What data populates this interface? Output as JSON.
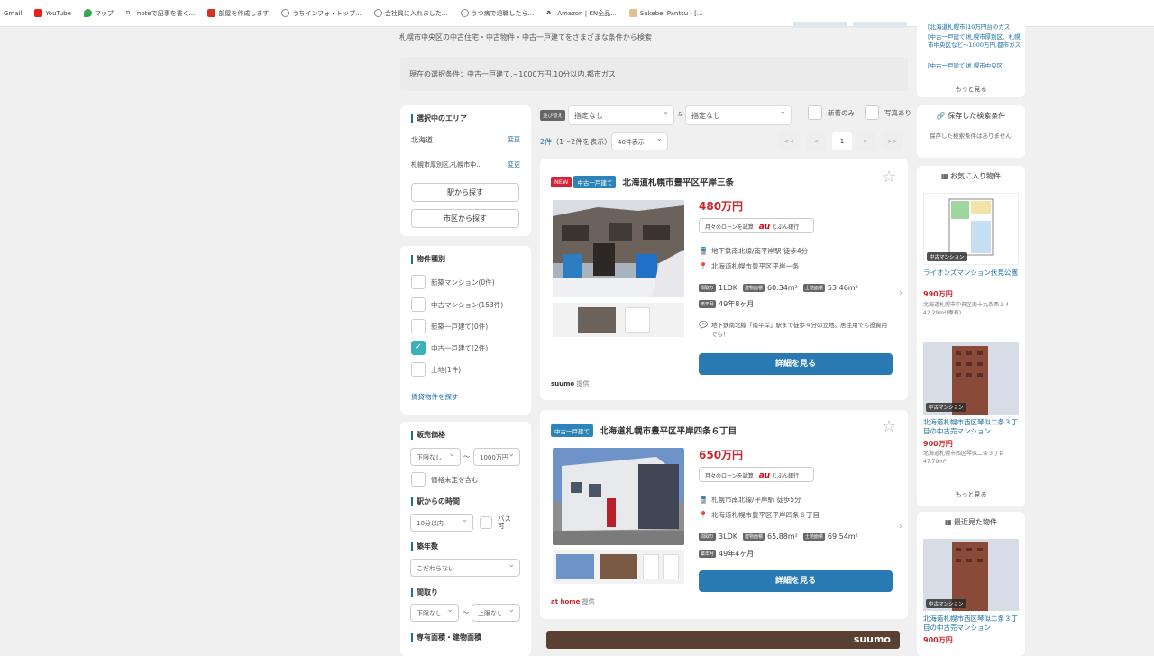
{
  "bookmarks": [
    {
      "label": "Gmail",
      "color": "#ffffff"
    },
    {
      "label": "YouTube",
      "color": "#e62117"
    },
    {
      "label": "マップ",
      "color": "#34a853"
    },
    {
      "label": "noteで記事を書く...",
      "color": "#222222"
    },
    {
      "label": "部屋を作成します",
      "color": "#d93025"
    },
    {
      "label": "うちインフォ・トップ...",
      "color": "#999999"
    },
    {
      "label": "会社員に入れました...",
      "color": "#999999"
    },
    {
      "label": "うつ病で退職したら...",
      "color": "#999999"
    },
    {
      "label": "Amazon | KN全品...",
      "color": "#222222"
    },
    {
      "label": "Sukebei Pantsu - [...",
      "color": "#e0c090"
    }
  ],
  "page": {
    "subtitle": "札幌市中央区の中古住宅・中古物件・中古一戸建てをさまざまな条件から検索",
    "current_conditions": "現在の選択条件：中古一戸建て,~1000万円,10分以内,都市ガス"
  },
  "sidebar": {
    "area_title": "選択中のエリア",
    "area1": "北海道",
    "area2": "札幌市厚別区,札幌市中...",
    "change": "変更",
    "station_btn": "駅から探す",
    "city_btn": "市区から探す",
    "type_title": "物件種別",
    "types": [
      {
        "label": "新築マンション(0件)",
        "checked": false
      },
      {
        "label": "中古マンション(153件)",
        "checked": false
      },
      {
        "label": "新築一戸建て(0件)",
        "checked": false
      },
      {
        "label": "中古一戸建て(2件)",
        "checked": true
      },
      {
        "label": "土地(1件)",
        "checked": false
      }
    ],
    "rent_link": "賃貸物件を探す",
    "price_title": "販売価格",
    "price_min": "下限なし",
    "price_sep": "〜",
    "price_max": "1000万円",
    "price_undecided": "価格未定を含む",
    "walk_title": "駅からの時間",
    "walk_val": "10分以内",
    "bus": "バス可",
    "age_title": "築年数",
    "age_val": "こだわらない",
    "layout_title": "間取り",
    "layout_min": "下限なし",
    "layout_max": "上限なし",
    "area_size_title": "専有面積・建物面積"
  },
  "toolbar": {
    "sort_badge": "並び替え",
    "sort1": "指定なし",
    "amp": "&",
    "sort2": "指定なし",
    "newonly": "新着のみ",
    "photo": "写真あり",
    "count_num": "2件",
    "count_text": "（1〜2件を表示）",
    "perpage": "40件表示",
    "pager": [
      "<<",
      "<",
      "1",
      ">",
      ">>"
    ]
  },
  "listings": [
    {
      "new": "NEW",
      "type": "中古一戸建て",
      "title": "北海道札幌市豊平区平岸三条",
      "price": "480万円",
      "loan": "月々のローンを試算",
      "bank": "au",
      "bank_label": "じぶん銀行",
      "station": "地下鉄南北線/南平岸駅 徒歩4分",
      "address": "北海道札幌市豊平区平岸一条",
      "layout_tag": "間取り",
      "layout": "1LDK",
      "bld_tag": "建物面積",
      "bld": "60.34m²",
      "land_tag": "土地面積",
      "land": "53.46m²",
      "age_tag": "築年月",
      "age": "49年8ヶ月",
      "comment": "地下鉄南北線「南平岸」駅まで徒歩４分の立地。居住用でも投資用でも！",
      "detail": "詳細を見る",
      "source": "suumo",
      "source_tail": "提供"
    },
    {
      "type": "中古一戸建て",
      "title": "北海道札幌市豊平区平岸四条６丁目",
      "price": "650万円",
      "loan": "月々のローンを試算",
      "bank": "au",
      "bank_label": "じぶん銀行",
      "station": "札幌市南北線/平岸駅 徒歩5分",
      "address": "北海道札幌市豊平区平岸四条６丁目",
      "layout_tag": "間取り",
      "layout": "3LDK",
      "bld_tag": "建物面積",
      "bld": "65.88m²",
      "land_tag": "土地面積",
      "land": "69.54m²",
      "age_tag": "築年月",
      "age": "49年4ヶ月",
      "detail": "詳細を見る",
      "source": "at home",
      "source_tail": "提供"
    }
  ],
  "right": {
    "top_links": [
      "[北海道札幌市]10万円台のガス",
      "[中古一戸建て]札幌市厚別区、札幌市中央区など〜1000万円,都市ガス",
      "[中古一戸建て]札幌市中央区"
    ],
    "more": "もっと見る",
    "saved_title": "保存した検索条件",
    "saved_empty": "保存した検索条件はありません",
    "fav_title": "お気に入り物件",
    "fav": [
      {
        "tag": "中古マンション",
        "name": "ライオンズマンション伏見公園",
        "price": "990万円",
        "addr": "北海道札幌市中央区南十九条西１４ 42.29m²(専有)"
      },
      {
        "tag": "中古マンション",
        "name": "北海道札幌市西区琴似二条３丁目の中古売マンション",
        "price": "900万円",
        "addr": "北海道札幌市西区琴似二条３丁目 47.79m²"
      }
    ],
    "recent_title": "最近見た物件",
    "recent": {
      "tag": "中古マンション",
      "name": "北海道札幌市西区琴似二条３丁目の中古売マンション",
      "price": "900万円"
    }
  },
  "banner": {
    "brand": "suumo"
  }
}
